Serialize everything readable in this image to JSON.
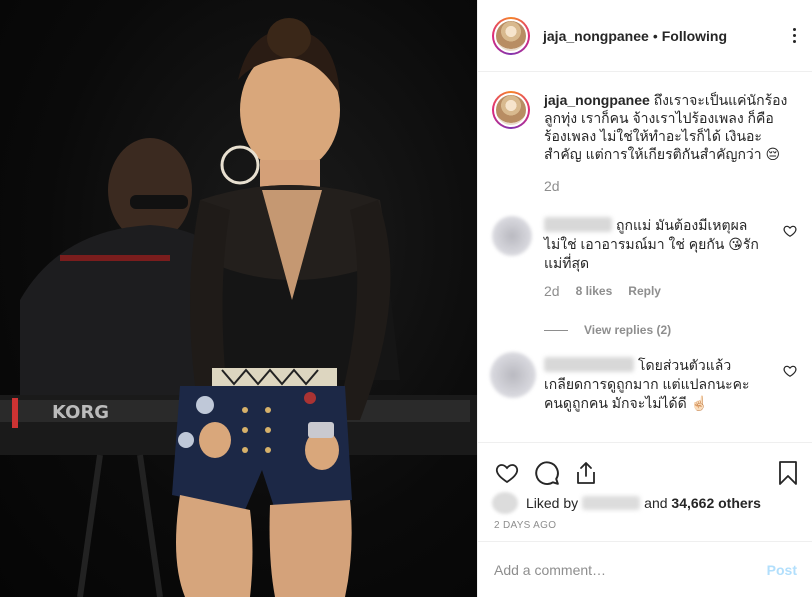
{
  "header": {
    "username": "jaja_nongpanee",
    "separator": "•",
    "follow_status": "Following"
  },
  "caption": {
    "username": "jaja_nongpanee",
    "text": "ถึงเราจะเป็นแค่นักร้องลูกทุ่ง เราก็คน จ้างเราไปร้องเพลง ก็คือร้องเพลง ไม่ใช่ให้ทำอะไรก็ได้ เงินอะสำคัญ แต่การให้เกียรติกันสำคัญกว่า 😔",
    "time": "2d"
  },
  "comments": [
    {
      "text": "ถูกแม่ มันต้องมีเหตุผล ไม่ใช่ เอาอารมณ์มา ใช่ คุยกัน 😘รักแม่ที่สุด",
      "time": "2d",
      "likes": "8 likes",
      "reply": "Reply",
      "view_replies": "View replies (2)"
    },
    {
      "text": "โดยส่วนตัวแล้ว เกลียดการดูถูกมาก แต่แปลกนะคะ คนดูถูกคน มักจะไม่ได้ดี ☝🏻"
    }
  ],
  "likes": {
    "prefix": "Liked by",
    "connector": "and",
    "others": "34,662 others"
  },
  "timestamp": "2 DAYS AGO",
  "add_comment": {
    "placeholder": "Add a comment…",
    "post_label": "Post"
  },
  "icons": {
    "like": "heart-icon",
    "comment": "comment-icon",
    "share": "share-icon",
    "save": "bookmark-icon",
    "more": "more-icon"
  },
  "colors": {
    "text": "#262626",
    "muted": "#8e8e8e",
    "post_disabled": "#b2dffc",
    "border": "#efefef"
  }
}
